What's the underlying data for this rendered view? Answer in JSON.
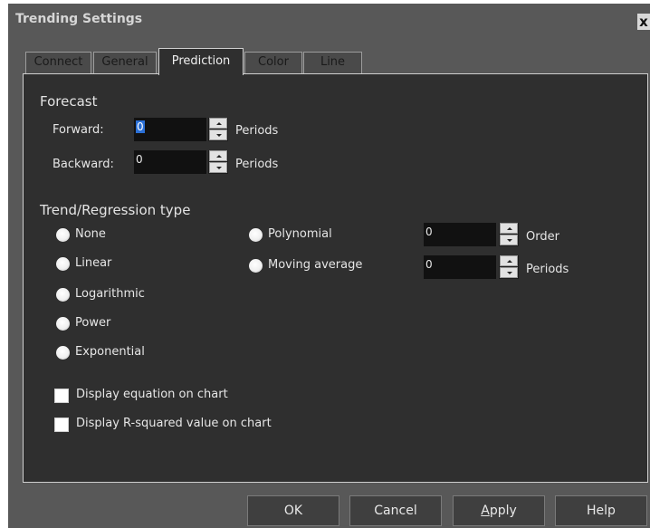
{
  "window": {
    "title": "Trending Settings",
    "close": "x"
  },
  "tabs": [
    "Connect",
    "General",
    "Prediction",
    "Color",
    "Line"
  ],
  "active_tab": "Prediction",
  "forecast": {
    "title": "Forecast",
    "forward_label": "Forward:",
    "forward_value": "0",
    "backward_label": "Backward:",
    "backward_value": "0",
    "unit": "Periods"
  },
  "trend": {
    "title": "Trend/Regression type",
    "options_left": [
      "None",
      "Linear",
      "Logarithmic",
      "Power",
      "Exponential"
    ],
    "options_right": [
      "Polynomial",
      "Moving average"
    ],
    "polynomial_value": "0",
    "polynomial_unit": "Order",
    "moving_value": "0",
    "moving_unit": "Periods"
  },
  "checks": [
    "Display equation on chart",
    "Display R-squared value on chart"
  ],
  "buttons": {
    "ok": "OK",
    "cancel": "Cancel",
    "apply_first": "A",
    "apply_rest": "pply",
    "help": "Help"
  }
}
